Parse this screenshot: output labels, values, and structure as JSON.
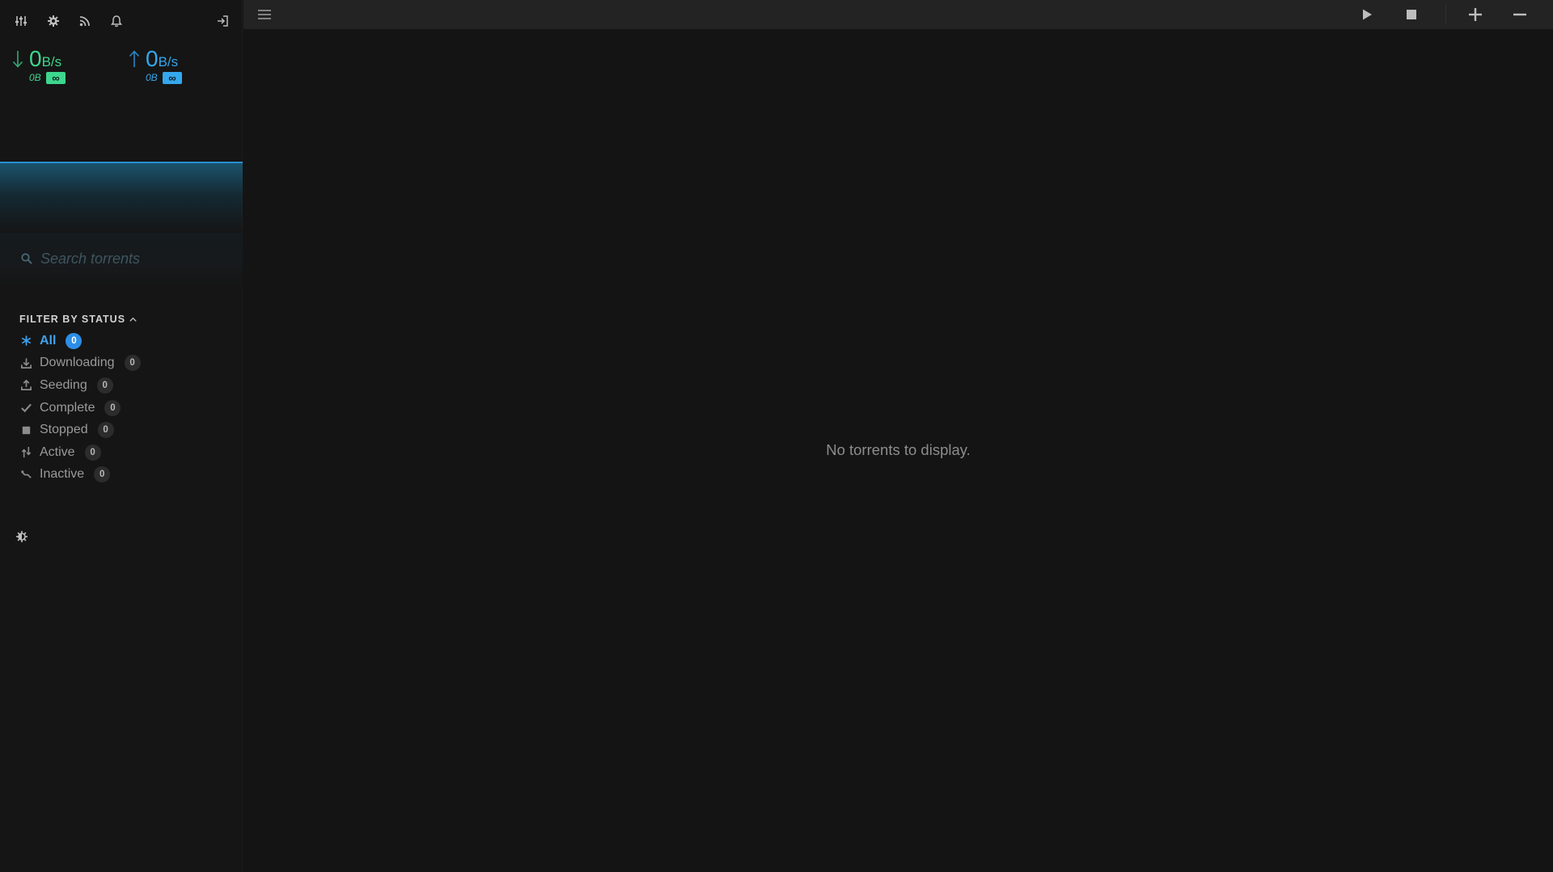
{
  "sidebar": {
    "toolbar": {
      "icons": [
        "mixer-icon",
        "gear-icon",
        "rss-icon",
        "bell-icon",
        "logout-icon"
      ]
    },
    "download": {
      "rate_value": "0",
      "rate_unit": "B/s",
      "total": "0B",
      "limit": "∞",
      "color": "#3dd68c"
    },
    "upload": {
      "rate_value": "0",
      "rate_unit": "B/s",
      "total": "0B",
      "limit": "∞",
      "color": "#35a7ec"
    },
    "search": {
      "placeholder": "Search torrents",
      "value": ""
    },
    "filter_heading": "FILTER BY STATUS",
    "filters": [
      {
        "label": "All",
        "count": "0",
        "icon": "asterisk-icon",
        "active": true
      },
      {
        "label": "Downloading",
        "count": "0",
        "icon": "download-tray-icon",
        "active": false
      },
      {
        "label": "Seeding",
        "count": "0",
        "icon": "upload-tray-icon",
        "active": false
      },
      {
        "label": "Complete",
        "count": "0",
        "icon": "checkmark-icon",
        "active": false
      },
      {
        "label": "Stopped",
        "count": "0",
        "icon": "stop-square-icon",
        "active": false
      },
      {
        "label": "Active",
        "count": "0",
        "icon": "transfer-arrows-icon",
        "active": false
      },
      {
        "label": "Inactive",
        "count": "0",
        "icon": "idle-line-icon",
        "active": false
      }
    ]
  },
  "topbar": {
    "icons": [
      "menu-icon",
      "play-icon",
      "stop-icon",
      "plus-icon",
      "minus-icon"
    ]
  },
  "main": {
    "empty_message": "No torrents to display."
  },
  "colors": {
    "accent": "#2d8ee6",
    "download": "#3dd68c",
    "upload": "#35a7ec",
    "background": "#141414"
  }
}
